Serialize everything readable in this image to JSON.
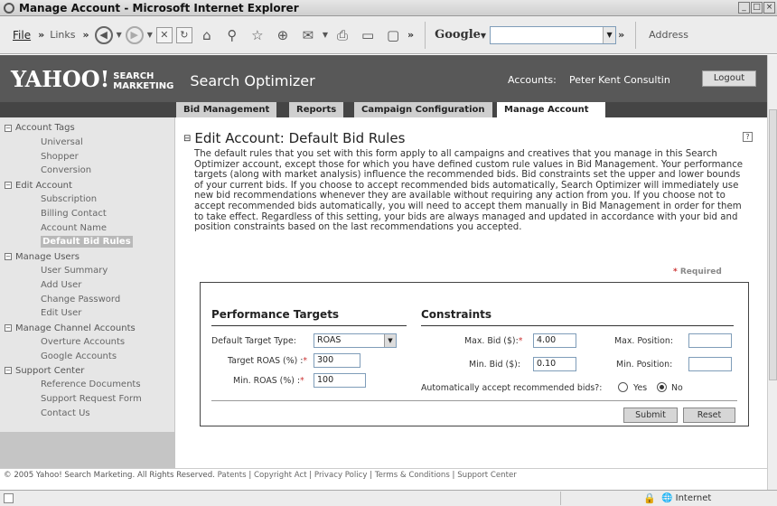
{
  "window": {
    "title": "Manage Account - Microsoft Internet Explorer"
  },
  "toolbar": {
    "file_menu": "File",
    "links": "Links",
    "google": "Google",
    "address": "Address"
  },
  "header": {
    "logo": "YAHOO!",
    "logo_sub_1": "SEARCH",
    "logo_sub_2": "MARKETING",
    "product": "Search Optimizer",
    "accounts_label": "Accounts:",
    "account_name": "Peter Kent Consultin",
    "logout": "Logout"
  },
  "tabs": [
    {
      "label": "Bid Management"
    },
    {
      "label": "Reports"
    },
    {
      "label": "Campaign Configuration"
    },
    {
      "label": "Manage Account"
    }
  ],
  "sidebar": {
    "sections": [
      {
        "label": "Account Tags",
        "items": [
          "Universal",
          "Shopper",
          "Conversion"
        ]
      },
      {
        "label": "Edit Account",
        "items": [
          "Subscription",
          "Billing Contact",
          "Account Name",
          "Default Bid Rules"
        ]
      },
      {
        "label": "Manage Users",
        "items": [
          "User Summary",
          "Add User",
          "Change Password",
          "Edit User"
        ]
      },
      {
        "label": "Manage Channel Accounts",
        "items": [
          "Overture Accounts",
          "Google Accounts"
        ]
      },
      {
        "label": "Support Center",
        "items": [
          "Reference Documents",
          "Support Request Form",
          "Contact Us"
        ]
      }
    ]
  },
  "page": {
    "title": "Edit Account: Default Bid Rules",
    "help": "?",
    "description": "The default rules that you set with this form apply to all campaigns and creatives that you manage in this Search Optimizer account, except those for which you have defined custom rule values in Bid Management. Your performance targets (along with market analysis) influence the recommended bids. Bid constraints set the upper and lower bounds of your current bids. If you choose to accept recommended bids automatically, Search Optimizer will immediately use new bid recommendations whenever they are available without requiring any action from you. If you choose not to accept recommended bids automatically, you will need to accept them manually in Bid Management in order for them to take effect. Regardless of this setting, your bids are always managed and updated in accordance with your bid and position constraints based on the last recommendations you accepted.",
    "required": "Required",
    "required_star": "*"
  },
  "form": {
    "performance_heading": "Performance Targets",
    "constraints_heading": "Constraints",
    "target_type_label": "Default Target Type:",
    "target_type_value": "ROAS",
    "target_roas_label": "Target ROAS (%) :",
    "target_roas_value": "300",
    "min_roas_label": "Min. ROAS (%) :",
    "min_roas_value": "100",
    "max_bid_label": "Max. Bid ($):",
    "max_bid_value": "4.00",
    "min_bid_label": "Min. Bid ($):",
    "min_bid_value": "0.10",
    "max_position_label": "Max. Position:",
    "max_position_value": "",
    "min_position_label": "Min. Position:",
    "min_position_value": "",
    "auto_accept_label": "Automatically accept recommended bids?:",
    "yes_label": "Yes",
    "no_label": "No",
    "auto_accept_selected": "No",
    "submit": "Submit",
    "reset": "Reset",
    "star": "*"
  },
  "footer": {
    "copyright": "© 2005 Yahoo! Search Marketing. All Rights Reserved.",
    "links": [
      "Patents",
      "Copyright Act",
      "Privacy Policy",
      "Terms & Conditions",
      "Support Center"
    ]
  },
  "status": {
    "zone": "Internet"
  }
}
